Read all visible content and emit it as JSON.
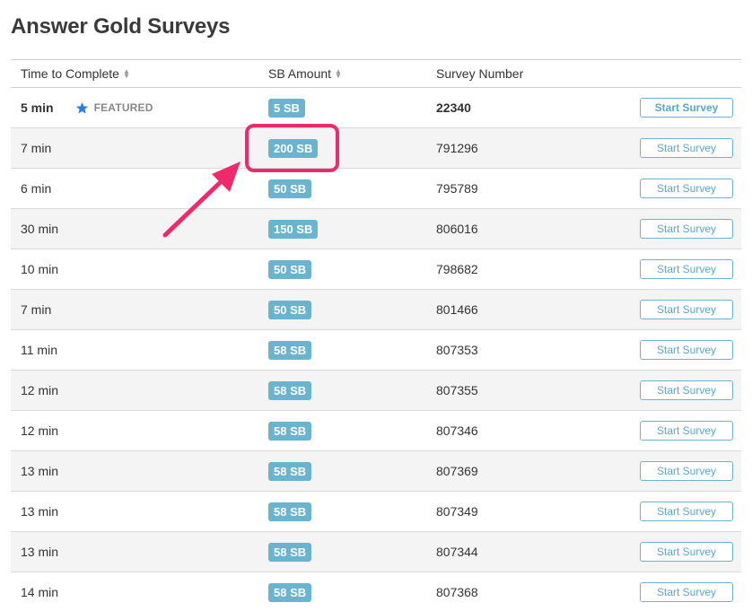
{
  "page": {
    "title": "Answer Gold Surveys"
  },
  "table": {
    "headers": {
      "time": "Time to Complete",
      "sb": "SB Amount",
      "number": "Survey Number"
    },
    "featured_label": "FEATURED",
    "rows": [
      {
        "time": "5 min",
        "sb": "5 SB",
        "number": "22340",
        "button": "Start Survey"
      },
      {
        "time": "7 min",
        "sb": "200 SB",
        "number": "791296",
        "button": "Start Survey"
      },
      {
        "time": "6 min",
        "sb": "50 SB",
        "number": "795789",
        "button": "Start Survey"
      },
      {
        "time": "30 min",
        "sb": "150 SB",
        "number": "806016",
        "button": "Start Survey"
      },
      {
        "time": "10 min",
        "sb": "50 SB",
        "number": "798682",
        "button": "Start Survey"
      },
      {
        "time": "7 min",
        "sb": "50 SB",
        "number": "801466",
        "button": "Start Survey"
      },
      {
        "time": "11 min",
        "sb": "58 SB",
        "number": "807353",
        "button": "Start Survey"
      },
      {
        "time": "12 min",
        "sb": "58 SB",
        "number": "807355",
        "button": "Start Survey"
      },
      {
        "time": "12 min",
        "sb": "58 SB",
        "number": "807346",
        "button": "Start Survey"
      },
      {
        "time": "13 min",
        "sb": "58 SB",
        "number": "807369",
        "button": "Start Survey"
      },
      {
        "time": "13 min",
        "sb": "58 SB",
        "number": "807349",
        "button": "Start Survey"
      },
      {
        "time": "13 min",
        "sb": "58 SB",
        "number": "807344",
        "button": "Start Survey"
      },
      {
        "time": "14 min",
        "sb": "58 SB",
        "number": "807368",
        "button": "Start Survey"
      }
    ]
  },
  "colors": {
    "badge": "#6ab4cf",
    "button_border": "#6ab4cf",
    "annotation": "#ee2a6d",
    "featured_star": "#2a7de1"
  },
  "icons": {
    "sort": "sort-icon",
    "featured": "star-icon",
    "annotation": "arrow-icon"
  }
}
